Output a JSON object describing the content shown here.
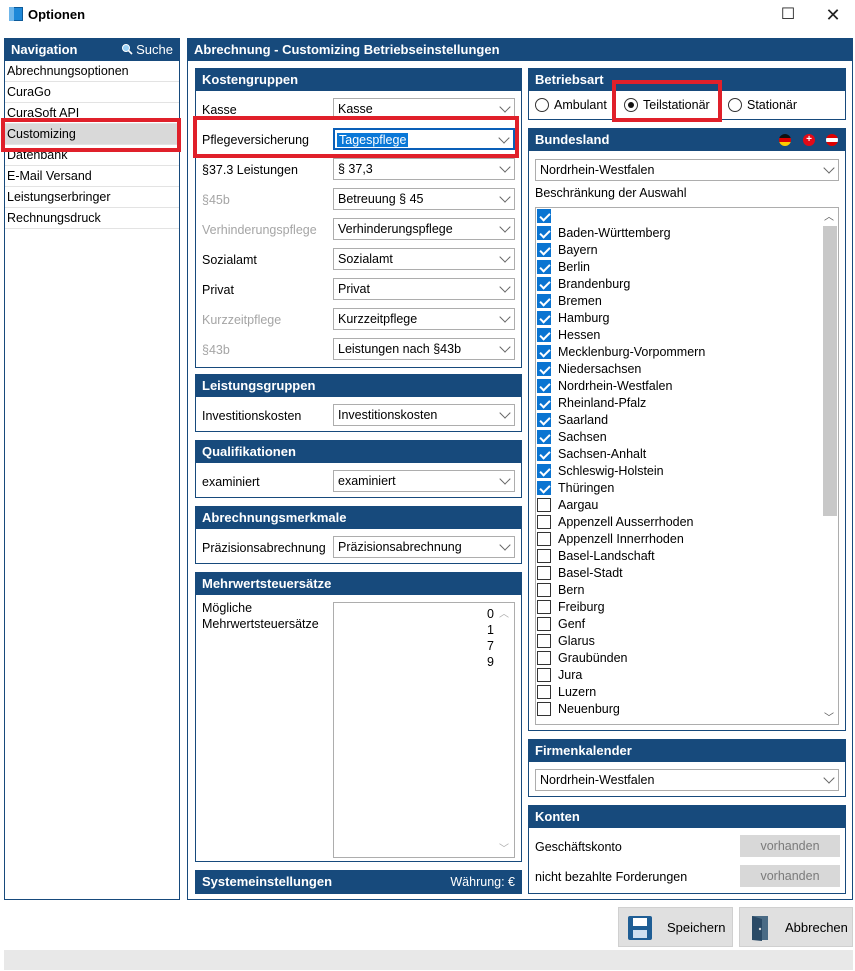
{
  "window": {
    "title": "Optionen",
    "maximize_glyph": "☐",
    "close_glyph": "✕"
  },
  "nav": {
    "title": "Navigation",
    "search_label": "Suche",
    "items": [
      {
        "label": "Abrechnungsoptionen"
      },
      {
        "label": "CuraGo"
      },
      {
        "label": "CuraSoft API"
      },
      {
        "label": "Customizing",
        "selected": true
      },
      {
        "label": "Datenbank"
      },
      {
        "label": "E-Mail Versand"
      },
      {
        "label": "Leistungserbringer"
      },
      {
        "label": "Rechnungsdruck"
      }
    ]
  },
  "main": {
    "title": "Abrechnung - Customizing Betriebseinstellungen"
  },
  "kostengruppen": {
    "title": "Kostengruppen",
    "rows": [
      {
        "label": "Kasse",
        "value": "Kasse",
        "disabled": false
      },
      {
        "label": "Pflegeversicherung",
        "value": "Tagespflege",
        "disabled": false,
        "active": true
      },
      {
        "label": "§37.3 Leistungen",
        "value": "§ 37,3",
        "disabled": false
      },
      {
        "label": "§45b",
        "value": "Betreuung § 45",
        "disabled": true
      },
      {
        "label": "Verhinderungspflege",
        "value": "Verhinderungspflege",
        "disabled": true
      },
      {
        "label": "Sozialamt",
        "value": "Sozialamt",
        "disabled": false
      },
      {
        "label": "Privat",
        "value": "Privat",
        "disabled": false
      },
      {
        "label": "Kurzzeitpflege",
        "value": "Kurzzeitpflege",
        "disabled": true
      },
      {
        "label": "§43b",
        "value": "Leistungen nach §43b",
        "disabled": true
      }
    ]
  },
  "leistungsgruppen": {
    "title": "Leistungsgruppen",
    "label": "Investitionskosten",
    "value": "Investitionskosten"
  },
  "qualifikationen": {
    "title": "Qualifikationen",
    "label": "examiniert",
    "value": "examiniert"
  },
  "abrechnungsmerkmale": {
    "title": "Abrechnungsmerkmale",
    "label": "Präzisionsabrechnung",
    "value": "Präzisionsabrechnung"
  },
  "mwst": {
    "title": "Mehrwertsteuersätze",
    "label_line1": "Mögliche",
    "label_line2": "Mehrwertsteuersätze",
    "values": [
      "0",
      "1",
      "7",
      "9"
    ]
  },
  "systemeinstellungen": {
    "title": "Systemeinstellungen",
    "currency": "Währung: €"
  },
  "betriebsart": {
    "title": "Betriebsart",
    "options": [
      {
        "label": "Ambulant",
        "selected": false
      },
      {
        "label": "Teilstationär",
        "selected": true
      },
      {
        "label": "Stationär",
        "selected": false
      }
    ]
  },
  "bundesland": {
    "title": "Bundesland",
    "selected": "Nordrhein-Westfalen",
    "restriction_label": "Beschränkung der Auswahl",
    "items": [
      {
        "label": "",
        "checked": true
      },
      {
        "label": "Baden-Württemberg",
        "checked": true
      },
      {
        "label": "Bayern",
        "checked": true
      },
      {
        "label": "Berlin",
        "checked": true
      },
      {
        "label": "Brandenburg",
        "checked": true
      },
      {
        "label": "Bremen",
        "checked": true
      },
      {
        "label": "Hamburg",
        "checked": true
      },
      {
        "label": "Hessen",
        "checked": true
      },
      {
        "label": "Mecklenburg-Vorpommern",
        "checked": true
      },
      {
        "label": "Niedersachsen",
        "checked": true
      },
      {
        "label": "Nordrhein-Westfalen",
        "checked": true
      },
      {
        "label": "Rheinland-Pfalz",
        "checked": true
      },
      {
        "label": "Saarland",
        "checked": true
      },
      {
        "label": "Sachsen",
        "checked": true
      },
      {
        "label": "Sachsen-Anhalt",
        "checked": true
      },
      {
        "label": "Schleswig-Holstein",
        "checked": true
      },
      {
        "label": "Thüringen",
        "checked": true
      },
      {
        "label": "Aargau",
        "checked": false
      },
      {
        "label": "Appenzell Ausserrhoden",
        "checked": false
      },
      {
        "label": "Appenzell Innerrhoden",
        "checked": false
      },
      {
        "label": "Basel-Landschaft",
        "checked": false
      },
      {
        "label": "Basel-Stadt",
        "checked": false
      },
      {
        "label": "Bern",
        "checked": false
      },
      {
        "label": "Freiburg",
        "checked": false
      },
      {
        "label": "Genf",
        "checked": false
      },
      {
        "label": "Glarus",
        "checked": false
      },
      {
        "label": "Graubünden",
        "checked": false
      },
      {
        "label": "Jura",
        "checked": false
      },
      {
        "label": "Luzern",
        "checked": false
      },
      {
        "label": "Neuenburg",
        "checked": false
      }
    ]
  },
  "firmenkalender": {
    "title": "Firmenkalender",
    "value": "Nordrhein-Westfalen"
  },
  "konten": {
    "title": "Konten",
    "rows": [
      {
        "label": "Geschäftskonto",
        "button": "vorhanden"
      },
      {
        "label": "nicht bezahlte Forderungen",
        "button": "vorhanden"
      }
    ]
  },
  "buttons": {
    "save": "Speichern",
    "cancel": "Abbrechen"
  },
  "colors": {
    "header_bg": "#174a7c",
    "highlight_red": "#e0202a",
    "check_blue": "#0a74d1"
  }
}
